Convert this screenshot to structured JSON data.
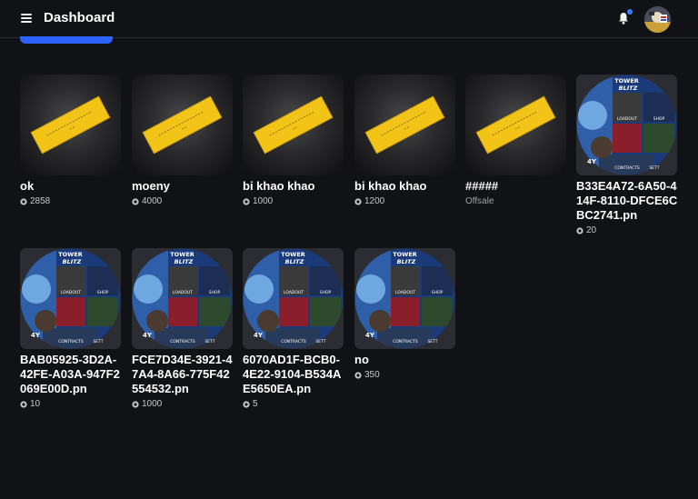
{
  "header": {
    "title": "Dashboard",
    "menu_icon": "hamburger-menu-icon",
    "bell_icon": "bell-icon",
    "notification_dot_color": "#3d7bff",
    "avatar_icon": "user-avatar"
  },
  "accent_color": "#2c63ff",
  "items": [
    {
      "name": "ok",
      "price": "2858",
      "thumb": "gold-ticket"
    },
    {
      "name": "moeny",
      "price": "4000",
      "thumb": "gold-ticket"
    },
    {
      "name": "bi khao khao",
      "price": "1000",
      "thumb": "gold-ticket"
    },
    {
      "name": "bi khao khao",
      "price": "1200",
      "thumb": "gold-ticket"
    },
    {
      "name": "#####",
      "status": "Offsale",
      "thumb": "gold-ticket"
    },
    {
      "name": "B33E4A72-6A50-414F-8110-DFCE6CBC2741.pn",
      "price": "20",
      "thumb": "tower-blitz-art"
    },
    {
      "name": "BAB05925-3D2A-42FE-A03A-947F2069E00D.pn",
      "price": "10",
      "thumb": "tower-blitz-art"
    },
    {
      "name": "FCE7D34E-3921-47A4-8A66-775F42554532.pn",
      "price": "1000",
      "thumb": "tower-blitz-art"
    },
    {
      "name": "6070AD1F-BCB0-4E22-9104-B534AE5650EA.pn",
      "price": "5",
      "thumb": "tower-blitz-art"
    },
    {
      "name": "no",
      "price": "350",
      "thumb": "tower-blitz-art"
    }
  ],
  "game_art": {
    "title_line1": "TOWER",
    "title_line2": "BLITZ",
    "panel_labels": [
      "LOADOUT",
      "SHOP",
      "CONTRACTS",
      "SETT"
    ],
    "corner_label": "4Y"
  }
}
